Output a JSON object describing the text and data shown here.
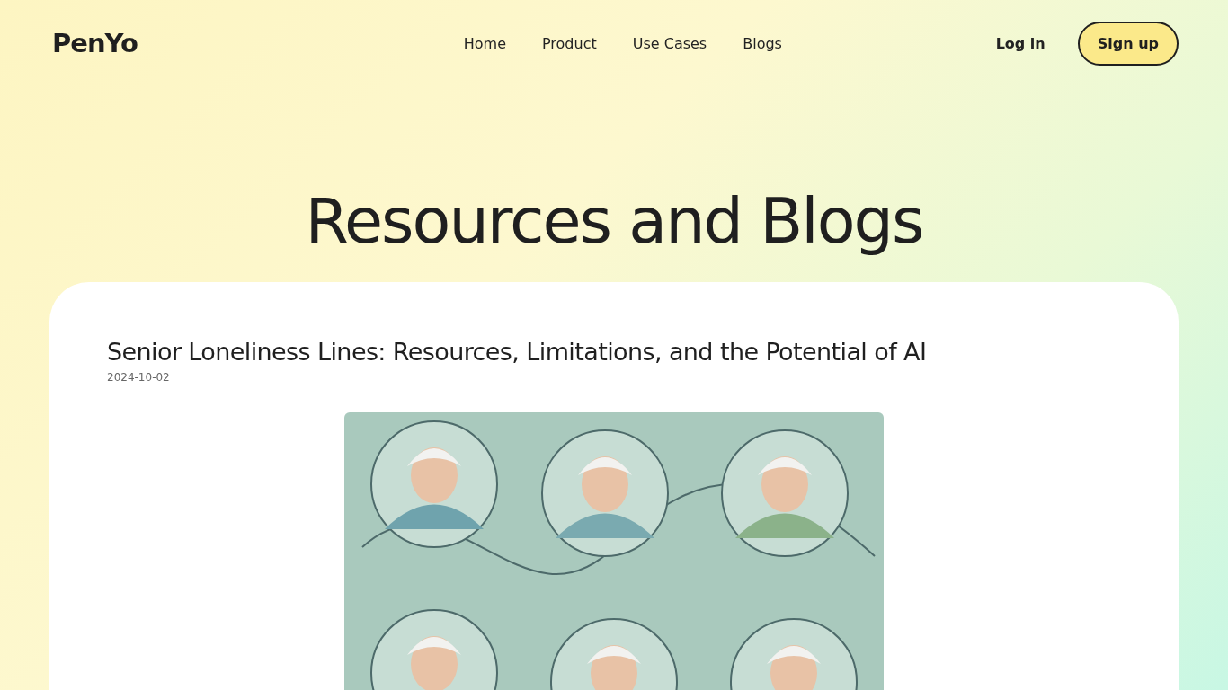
{
  "logo": "PenYo",
  "nav": [
    {
      "label": "Home"
    },
    {
      "label": "Product"
    },
    {
      "label": "Use Cases"
    },
    {
      "label": "Blogs"
    }
  ],
  "login": "Log in",
  "signup": "Sign up",
  "heading": "Resources and Blogs",
  "post": {
    "title": "Senior Loneliness Lines: Resources, Limitations, and the Potential of AI",
    "date": "2024-10-02"
  }
}
